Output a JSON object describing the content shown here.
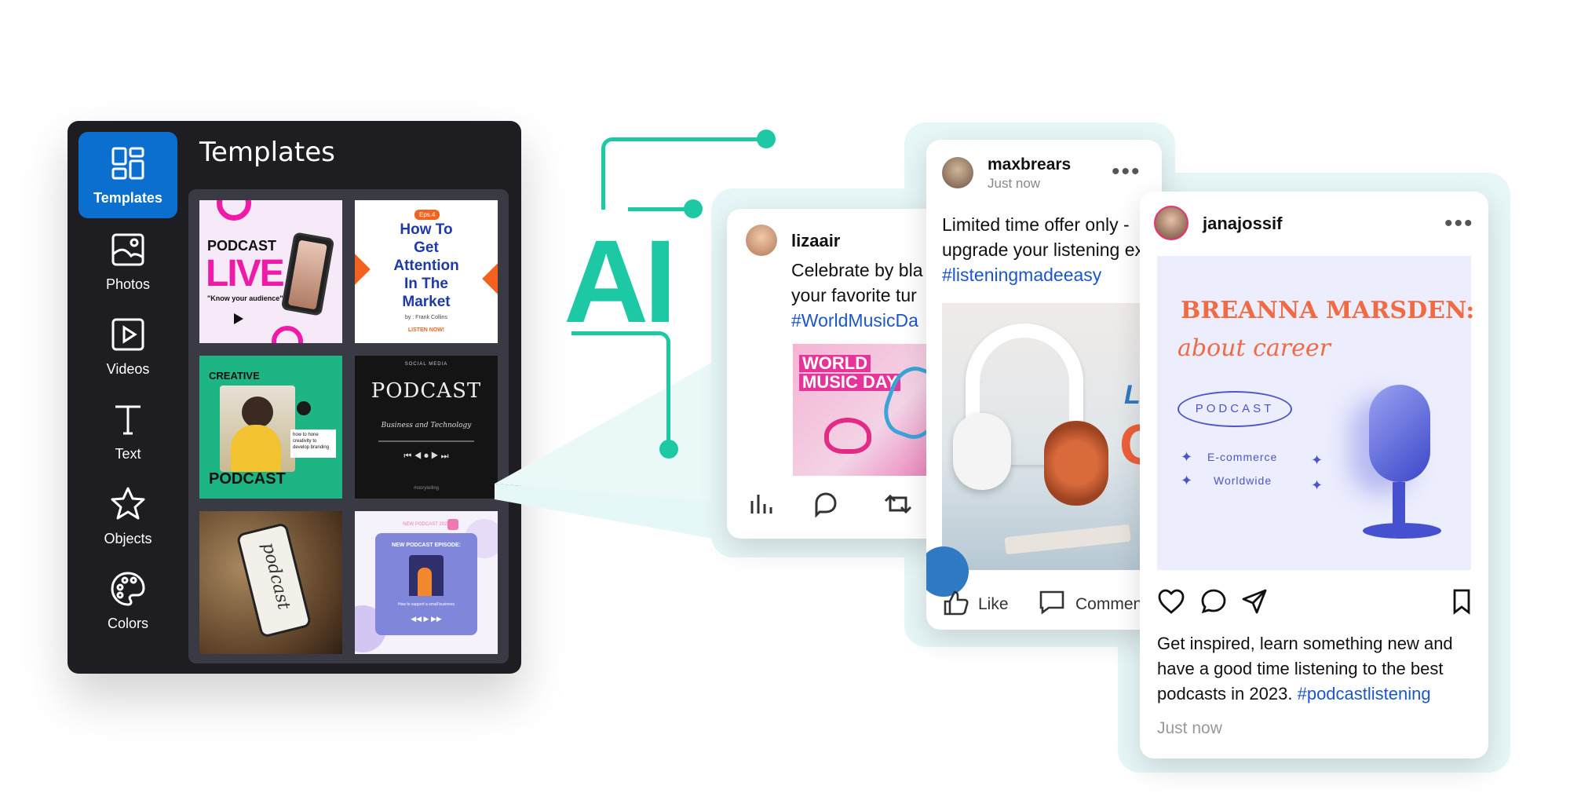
{
  "editor": {
    "panel_title": "Templates",
    "rail": [
      {
        "label": "Templates",
        "icon": "templates-icon",
        "active": true
      },
      {
        "label": "Photos",
        "icon": "photos-icon"
      },
      {
        "label": "Videos",
        "icon": "videos-icon"
      },
      {
        "label": "Text",
        "icon": "text-icon"
      },
      {
        "label": "Objects",
        "icon": "star-icon"
      },
      {
        "label": "Colors",
        "icon": "palette-icon"
      }
    ],
    "templates": {
      "t1": {
        "line1": "PODCAST",
        "line2": "LIVE",
        "tagline": "\"Know your audience\""
      },
      "t2": {
        "badge": "Eps.4",
        "lines": [
          "How To",
          "Get",
          "Attention",
          "In The",
          "Market"
        ],
        "byline": "by : Frank Collins",
        "cta": "LISTEN NOW!"
      },
      "t3": {
        "top": "CREATIVE",
        "bottom": "PODCAST",
        "note": "how to hone creativity to develop branding"
      },
      "t4": {
        "brand": "SOCIAL MEDIA",
        "title": "PODCAST",
        "subtitle": "Business and Technology",
        "footer": "#storytelling"
      },
      "t5": {
        "word": "podcast"
      },
      "t6": {
        "top": "NEW PODCAST 2023",
        "title": "NEW PODCAST EPISODE:",
        "caption": "How to support a small business"
      }
    }
  },
  "ai_label": "AI",
  "colors": {
    "accent": "#1dc9a4",
    "editor_bg": "#1d1d22",
    "active_blue": "#0b6fd0",
    "hashtag": "#1c56c9"
  },
  "posts": {
    "lizaair": {
      "username": "lizaair",
      "text_line1": "Celebrate by bla",
      "text_line2": "your favorite tur",
      "hashtag": "#WorldMusicDa",
      "image_text1": "WORLD",
      "image_text2": "MUSIC DAY"
    },
    "maxbrears": {
      "username": "maxbrears",
      "time": "Just now",
      "text_line1": "Limited time offer only -",
      "text_line2": "upgrade your listening ex",
      "hashtag": "#listeningmadeeasy",
      "like": "Like",
      "comment": "Commen",
      "image_text1": "Li",
      "image_text2": "O"
    },
    "janajossif": {
      "username": "janajossif",
      "promo_title": "BREANNA MARSDEN:",
      "promo_sub": "about career",
      "promo_pill": "PODCAST",
      "promo_item1": "E-commerce",
      "promo_item2": "Worldwide",
      "caption_line1": "Get inspired, learn something new and",
      "caption_line2": "have a good time listening to the best",
      "caption_line3": "podcasts in 2023.",
      "hashtag": "#podcastlistening",
      "time": "Just now"
    }
  }
}
